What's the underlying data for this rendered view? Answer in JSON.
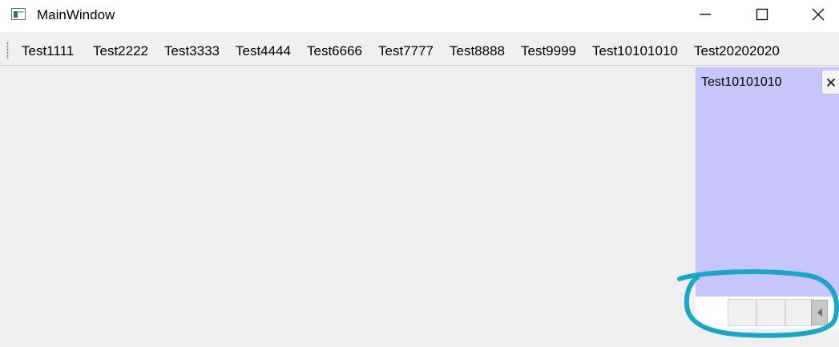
{
  "window": {
    "title": "MainWindow"
  },
  "menubar": {
    "items": [
      "Test1111",
      "Test2222",
      "Test3333",
      "Test4444",
      "Test6666",
      "Test7777",
      "Test8888",
      "Test9999",
      "Test10101010",
      "Test20202020"
    ]
  },
  "dock": {
    "title": "Test10101010",
    "close_label": "×"
  },
  "colors": {
    "dock_background": "#c8c4fc",
    "annotation_stroke": "#19a7c8"
  },
  "icons": [
    "app-icon",
    "minimize-icon",
    "maximize-icon",
    "close-icon",
    "scroll-left-icon"
  ]
}
